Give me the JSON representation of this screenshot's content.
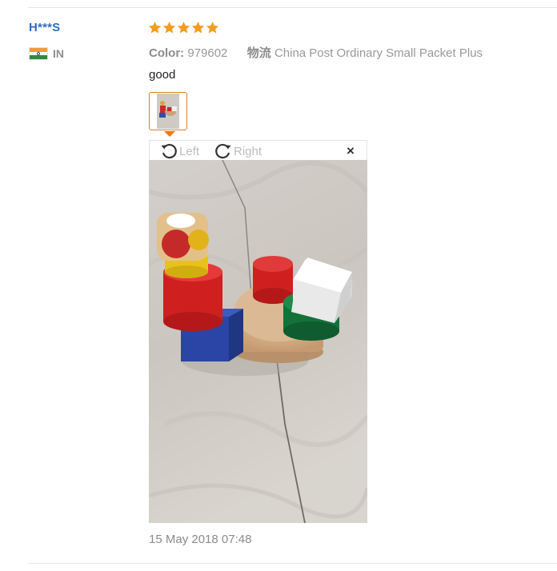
{
  "reviewer": {
    "name": "H***S",
    "country": "IN",
    "flag_icon": "india-flag-icon"
  },
  "rating": {
    "stars": 5,
    "max": 5,
    "color": "#f39c1f"
  },
  "meta": {
    "color_label": "Color:",
    "color_value": "979602",
    "logistics_label": "物流",
    "logistics_value": "China Post Ordinary Small Packet Plus"
  },
  "review": {
    "text": "good"
  },
  "viewer": {
    "rotate_left_label": "Left",
    "rotate_right_label": "Right",
    "close_label": "×",
    "rotate_left_icon": "rotate-left-icon",
    "rotate_right_icon": "rotate-right-icon"
  },
  "accent_color": "#e87a1d",
  "name_color": "#2f6bbf",
  "date": "15 May 2018 07:48"
}
